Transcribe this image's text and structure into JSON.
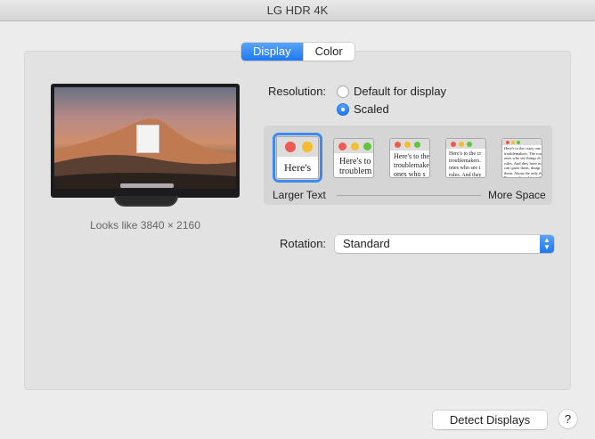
{
  "window": {
    "title": "LG HDR 4K"
  },
  "tabs": [
    {
      "label": "Display"
    },
    {
      "label": "Color"
    }
  ],
  "display_preview": {
    "looks_like": "Looks like 3840 × 2160"
  },
  "resolution": {
    "label": "Resolution:",
    "options": [
      {
        "label": "Default for display",
        "selected": false
      },
      {
        "label": "Scaled",
        "selected": true
      }
    ]
  },
  "scaling": {
    "left_label": "Larger Text",
    "right_label": "More Space",
    "thumbnails": [
      {
        "text": "Here's",
        "selected": true
      },
      {
        "text": "Here's to troublem",
        "selected": false
      },
      {
        "text": "Here's to the troublemake ones who s",
        "selected": false
      },
      {
        "text": "Here's to the cr troublemakers. ones who see t rules. And they",
        "selected": false
      },
      {
        "text": "Here's to the crazy one troublemakers. The rou ones who see things di rules. And they have no can quote them, disagr them. About the only thi Because they change th",
        "selected": false
      }
    ]
  },
  "rotation": {
    "label": "Rotation:",
    "value": "Standard"
  },
  "buttons": {
    "detect_displays": "Detect Displays",
    "help": "?"
  },
  "colors": {
    "accent": "#1d78f1",
    "traffic_red": "#ee5a52",
    "traffic_yellow": "#f4bd2f",
    "traffic_green": "#5fc53a"
  }
}
